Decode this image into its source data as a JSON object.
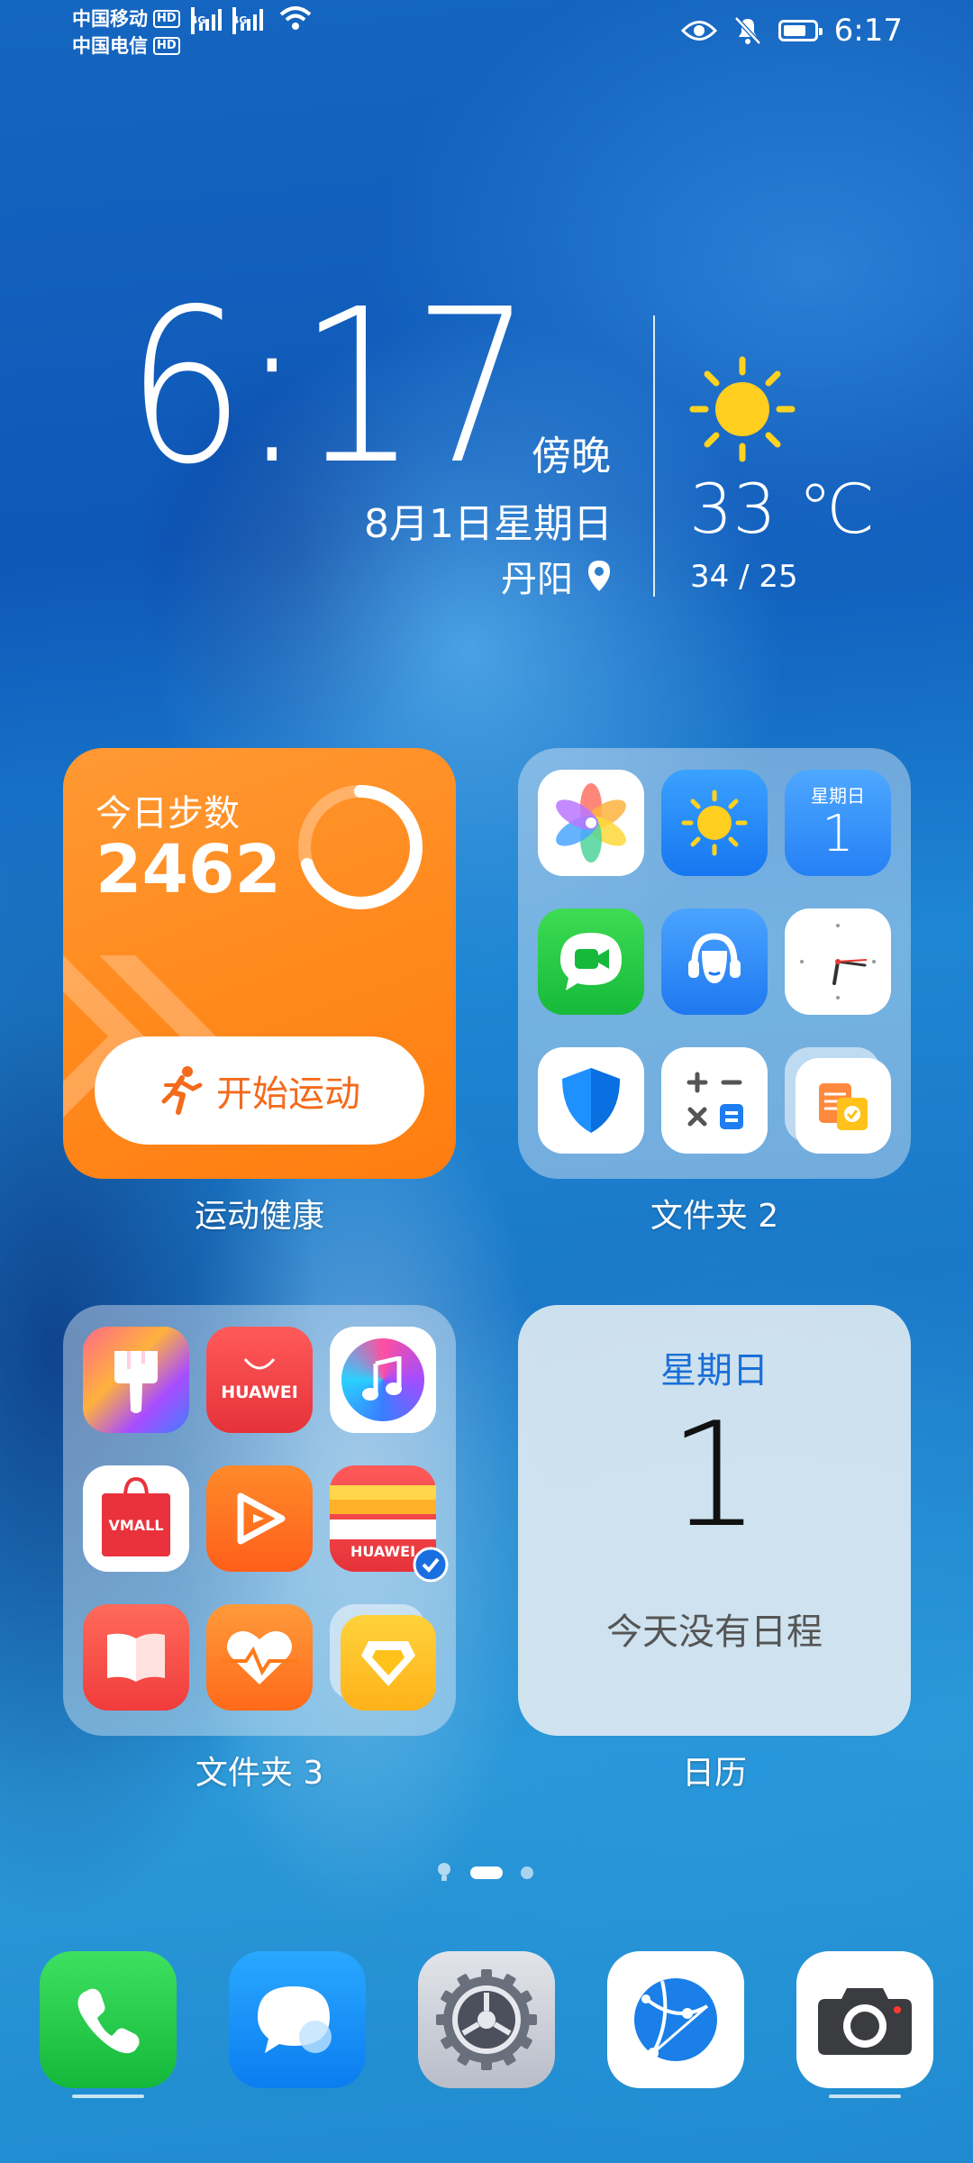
{
  "status_bar": {
    "carrier1": "中国移动",
    "carrier2": "中国电信",
    "hd": "HD",
    "network": "4G",
    "time": "6:17"
  },
  "clock_widget": {
    "time": "6:17",
    "period": "傍晚",
    "date": "8月1日星期日",
    "city": "丹阳",
    "temperature": "33 ℃",
    "temp_range": "34 / 25"
  },
  "health_widget": {
    "title": "今日步数",
    "steps": "2462",
    "button_label": "开始运动",
    "label": "运动健康",
    "progress": 0.7
  },
  "folder2": {
    "label": "文件夹 2",
    "calendar_icon_day": "星期日",
    "calendar_icon_num": "1",
    "apps": [
      "gallery-icon",
      "weather-icon",
      "calendar-icon",
      "meetime-icon",
      "support-icon",
      "clock-icon",
      "security-icon",
      "calculator-icon",
      "files-icon"
    ]
  },
  "folder3": {
    "label": "文件夹 3",
    "huawei_text": "HUAWEI",
    "vmall_text": "VMALL",
    "wallet_text": "HUAWEI",
    "apps": [
      "themes-icon",
      "appgallery-icon",
      "music-icon",
      "vmall-icon",
      "video-icon",
      "wallet-icon",
      "books-icon",
      "health-icon",
      "tips-icon"
    ]
  },
  "calendar_widget": {
    "weekday": "星期日",
    "day": "1",
    "empty_text": "今天没有日程",
    "label": "日历"
  },
  "dock": [
    "phone-icon",
    "messages-icon",
    "settings-icon",
    "browser-icon",
    "camera-icon"
  ],
  "colors": {
    "health_orange": "#ff8a1e",
    "calendar_blue": "#1a6fd8"
  }
}
